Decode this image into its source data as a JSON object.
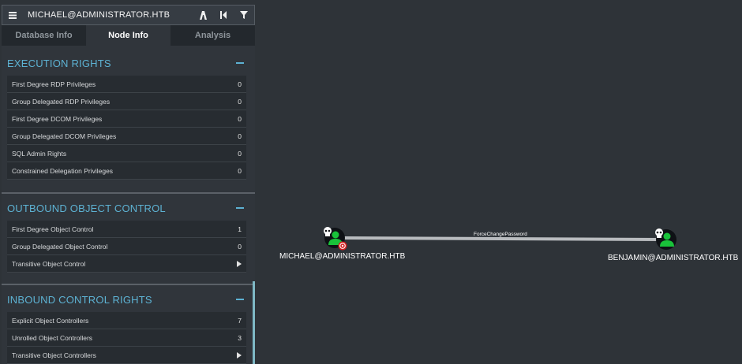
{
  "header": {
    "search_value": "MICHAEL@ADMINISTRATOR.HTB",
    "icons": [
      "menu-icon",
      "pathfinding-icon",
      "back-icon",
      "filter-icon"
    ]
  },
  "tabs": [
    {
      "label": "Database Info",
      "active": false
    },
    {
      "label": "Node Info",
      "active": true
    },
    {
      "label": "Analysis",
      "active": false
    }
  ],
  "sections": {
    "execution": {
      "title": "EXECUTION RIGHTS",
      "rows": [
        {
          "label": "First Degree RDP Privileges",
          "value": "0"
        },
        {
          "label": "Group Delegated RDP Privileges",
          "value": "0"
        },
        {
          "label": "First Degree DCOM Privileges",
          "value": "0"
        },
        {
          "label": "Group Delegated DCOM Privileges",
          "value": "0"
        },
        {
          "label": "SQL Admin Rights",
          "value": "0"
        },
        {
          "label": "Constrained Delegation Privileges",
          "value": "0"
        }
      ]
    },
    "outbound": {
      "title": "OUTBOUND OBJECT CONTROL",
      "rows": [
        {
          "label": "First Degree Object Control",
          "value": "1"
        },
        {
          "label": "Group Delegated Object Control",
          "value": "0"
        },
        {
          "label": "Transitive Object Control",
          "value": ""
        }
      ]
    },
    "inbound": {
      "title": "INBOUND CONTROL RIGHTS",
      "rows": [
        {
          "label": "Explicit Object Controllers",
          "value": "7"
        },
        {
          "label": "Unrolled Object Controllers",
          "value": "3"
        },
        {
          "label": "Transitive Object Controllers",
          "value": ""
        }
      ]
    }
  },
  "graph": {
    "source_node": "MICHAEL@ADMINISTRATOR.HTB",
    "target_node": "BENJAMIN@ADMINISTRATOR.HTB",
    "edge_label": "ForceChangePassword",
    "colors": {
      "node_bg": "#0e1115",
      "user_icon": "#19c23a",
      "skull": "#ffffff",
      "target_badge": "#d42020",
      "edge": "#c8c8c8"
    }
  }
}
